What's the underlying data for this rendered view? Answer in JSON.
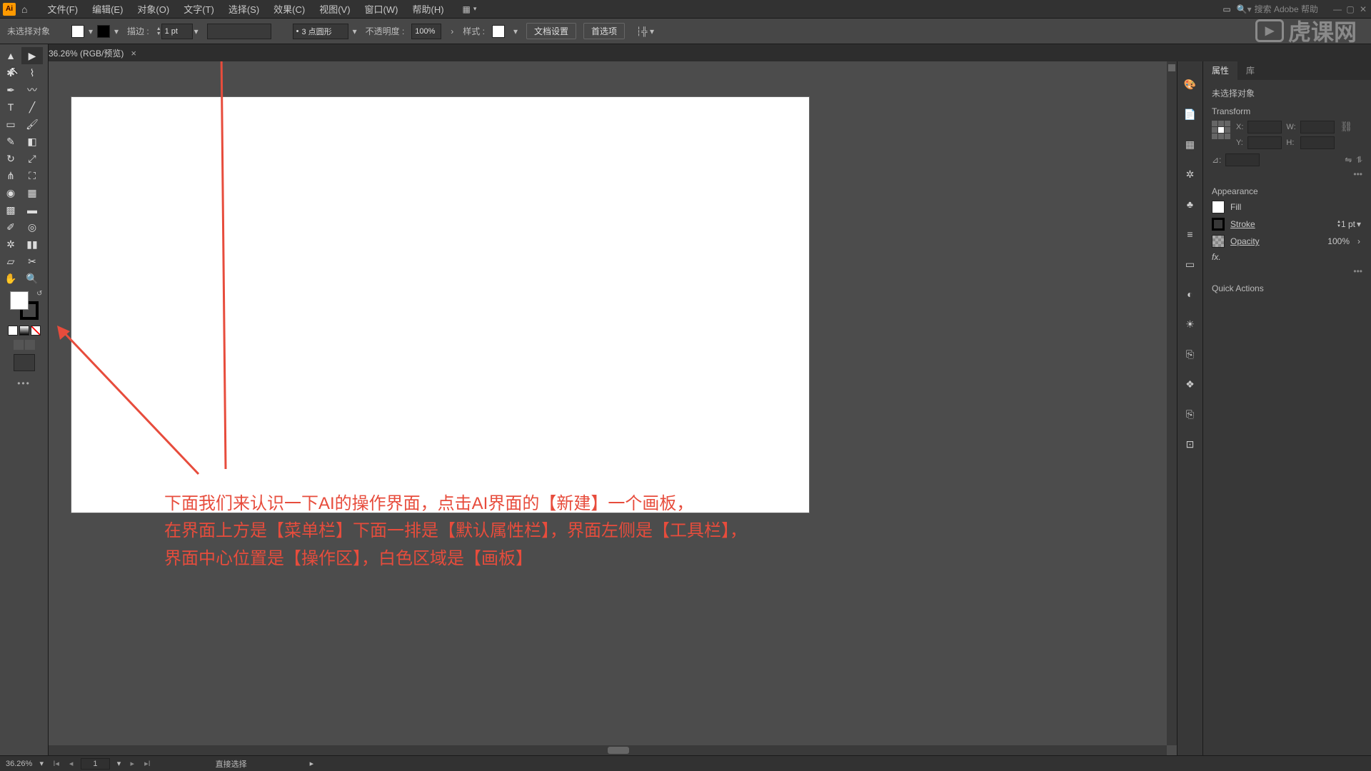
{
  "menubar": {
    "items": [
      "文件(F)",
      "编辑(E)",
      "对象(O)",
      "文字(T)",
      "选择(S)",
      "效果(C)",
      "视图(V)",
      "窗口(W)",
      "帮助(H)"
    ],
    "search_placeholder": "搜索 Adobe 帮助"
  },
  "propbar": {
    "no_selection": "未选择对象",
    "stroke_label": "描边 :",
    "stroke_value": "1 pt",
    "brush_value": "3 点圆形",
    "opacity_label": "不透明度 :",
    "opacity_value": "100%",
    "style_label": "样式 :",
    "doc_setup": "文档设置",
    "prefs": "首选项"
  },
  "doc_tab": "36.26% (RGB/预览)",
  "panel": {
    "tabs": [
      "属性",
      "库"
    ],
    "no_selection": "未选择对象",
    "transform_hdr": "Transform",
    "x_label": "X:",
    "y_label": "Y:",
    "w_label": "W:",
    "h_label": "H:",
    "angle_label": "⊿:",
    "appearance_hdr": "Appearance",
    "fill_label": "Fill",
    "stroke_label": "Stroke",
    "stroke_val": "1 pt",
    "opacity_label": "Opacity",
    "opacity_val": "100%",
    "fx_label": "fx.",
    "quick_actions": "Quick Actions"
  },
  "statusbar": {
    "zoom": "36.26%",
    "artboard_num": "1",
    "tool": "直接选择"
  },
  "annotation": {
    "line1": "下面我们来认识一下AI的操作界面，点击AI界面的【新建】一个画板，",
    "line2": "在界面上方是【菜单栏】下面一排是【默认属性栏】，界面左侧是【工具栏】，",
    "line3": "界面中心位置是【操作区】，白色区域是【画板】"
  },
  "watermark": "虎课网"
}
